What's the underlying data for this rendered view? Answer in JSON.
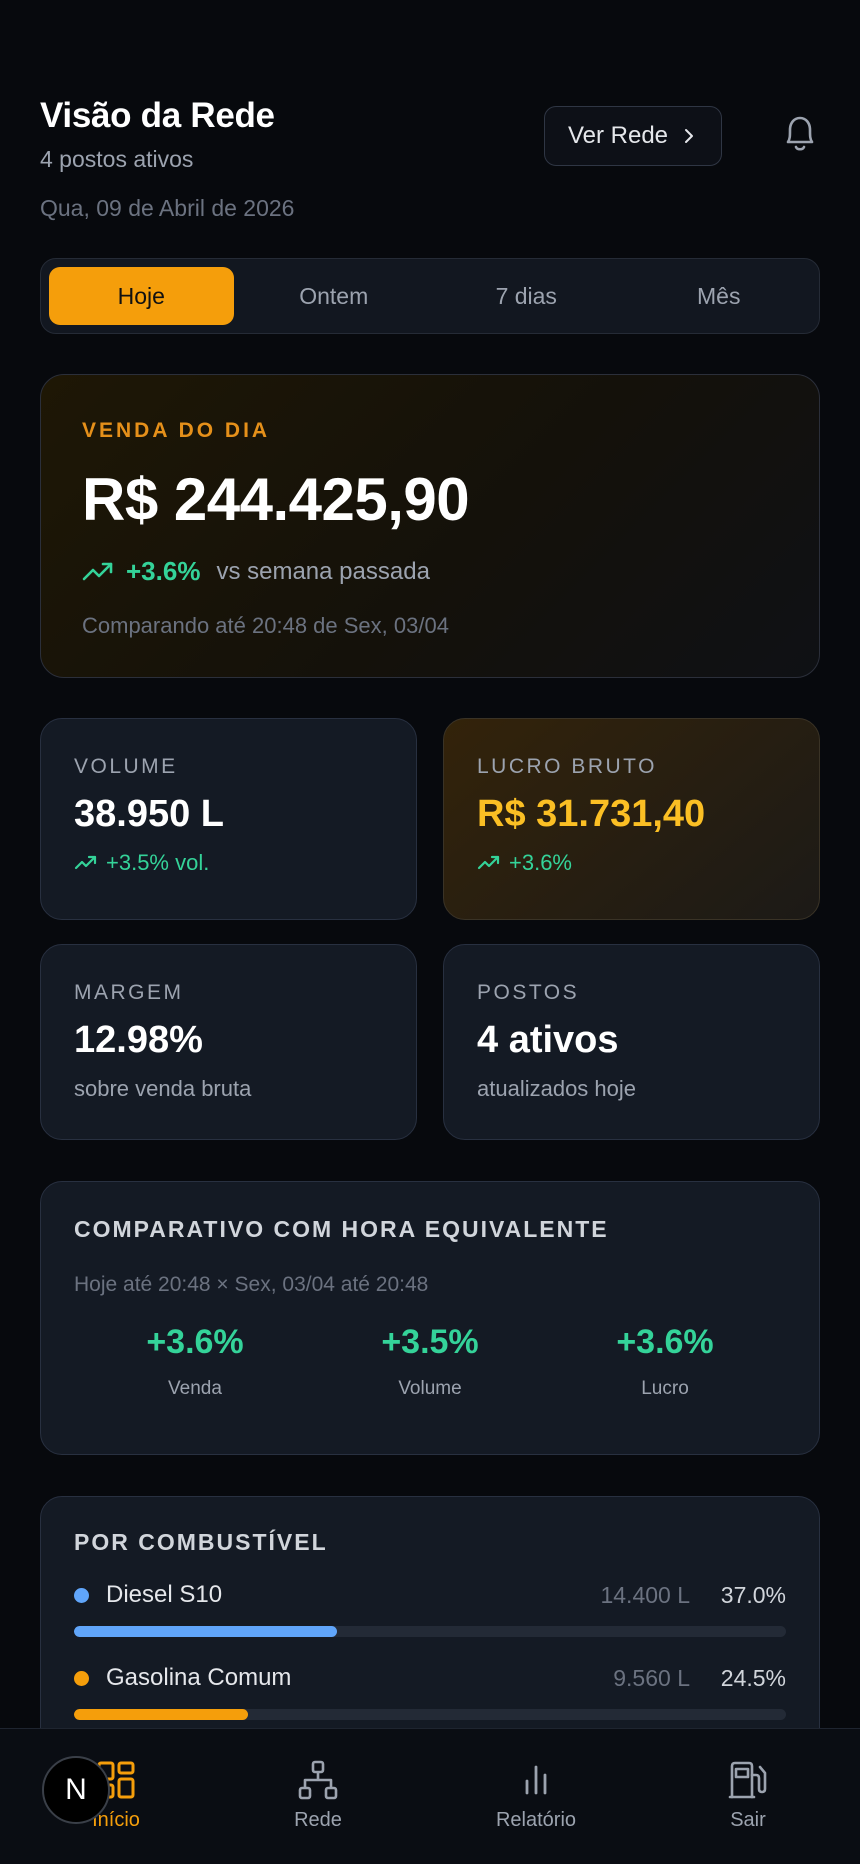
{
  "header": {
    "title": "Visão da Rede",
    "subtitle": "4 postos ativos",
    "date": "Qua, 09 de Abril de 2026",
    "ver_rede_label": "Ver Rede"
  },
  "period_tabs": [
    {
      "label": "Hoje",
      "active": true
    },
    {
      "label": "Ontem",
      "active": false
    },
    {
      "label": "7 dias",
      "active": false
    },
    {
      "label": "Mês",
      "active": false
    }
  ],
  "hero": {
    "label": "VENDA DO DIA",
    "value": "R$ 244.425,90",
    "trend_pct": "+3.6%",
    "trend_text": "vs semana passada",
    "compare_text": "Comparando até 20:48 de Sex, 03/04"
  },
  "stats": {
    "volume": {
      "label": "VOLUME",
      "value": "38.950 L",
      "sub": "+3.5% vol."
    },
    "lucro": {
      "label": "LUCRO BRUTO",
      "value": "R$ 31.731,40",
      "sub": "+3.6%"
    },
    "margem": {
      "label": "MARGEM",
      "value": "12.98%",
      "sub": "sobre venda bruta"
    },
    "postos": {
      "label": "POSTOS",
      "value": "4 ativos",
      "sub": "atualizados hoje"
    }
  },
  "comparativo": {
    "title": "COMPARATIVO COM HORA EQUIVALENTE",
    "subtitle": "Hoje até 20:48 × Sex, 03/04 até 20:48",
    "items": [
      {
        "value": "+3.6%",
        "label": "Venda"
      },
      {
        "value": "+3.5%",
        "label": "Volume"
      },
      {
        "value": "+3.6%",
        "label": "Lucro"
      }
    ]
  },
  "combustivel": {
    "title": "POR COMBUSTÍVEL",
    "items": [
      {
        "name": "Diesel S10",
        "volume": "14.400 L",
        "pct": "37.0%",
        "share": 0.37,
        "color": "#60a5fa"
      },
      {
        "name": "Gasolina Comum",
        "volume": "9.560 L",
        "pct": "24.5%",
        "share": 0.245,
        "color": "#f59e0b"
      }
    ]
  },
  "nav": {
    "items": [
      {
        "label": "Início",
        "icon": "dashboard-icon",
        "active": true
      },
      {
        "label": "Rede",
        "icon": "network-icon",
        "active": false
      },
      {
        "label": "Relatório",
        "icon": "bar-chart-icon",
        "active": false
      },
      {
        "label": "Sair",
        "icon": "fuel-pump-icon",
        "active": false
      }
    ],
    "badge": "N"
  },
  "colors": {
    "accent": "#f59e0b",
    "positive": "#34d399",
    "background": "#07090d",
    "card": "#141a24"
  }
}
